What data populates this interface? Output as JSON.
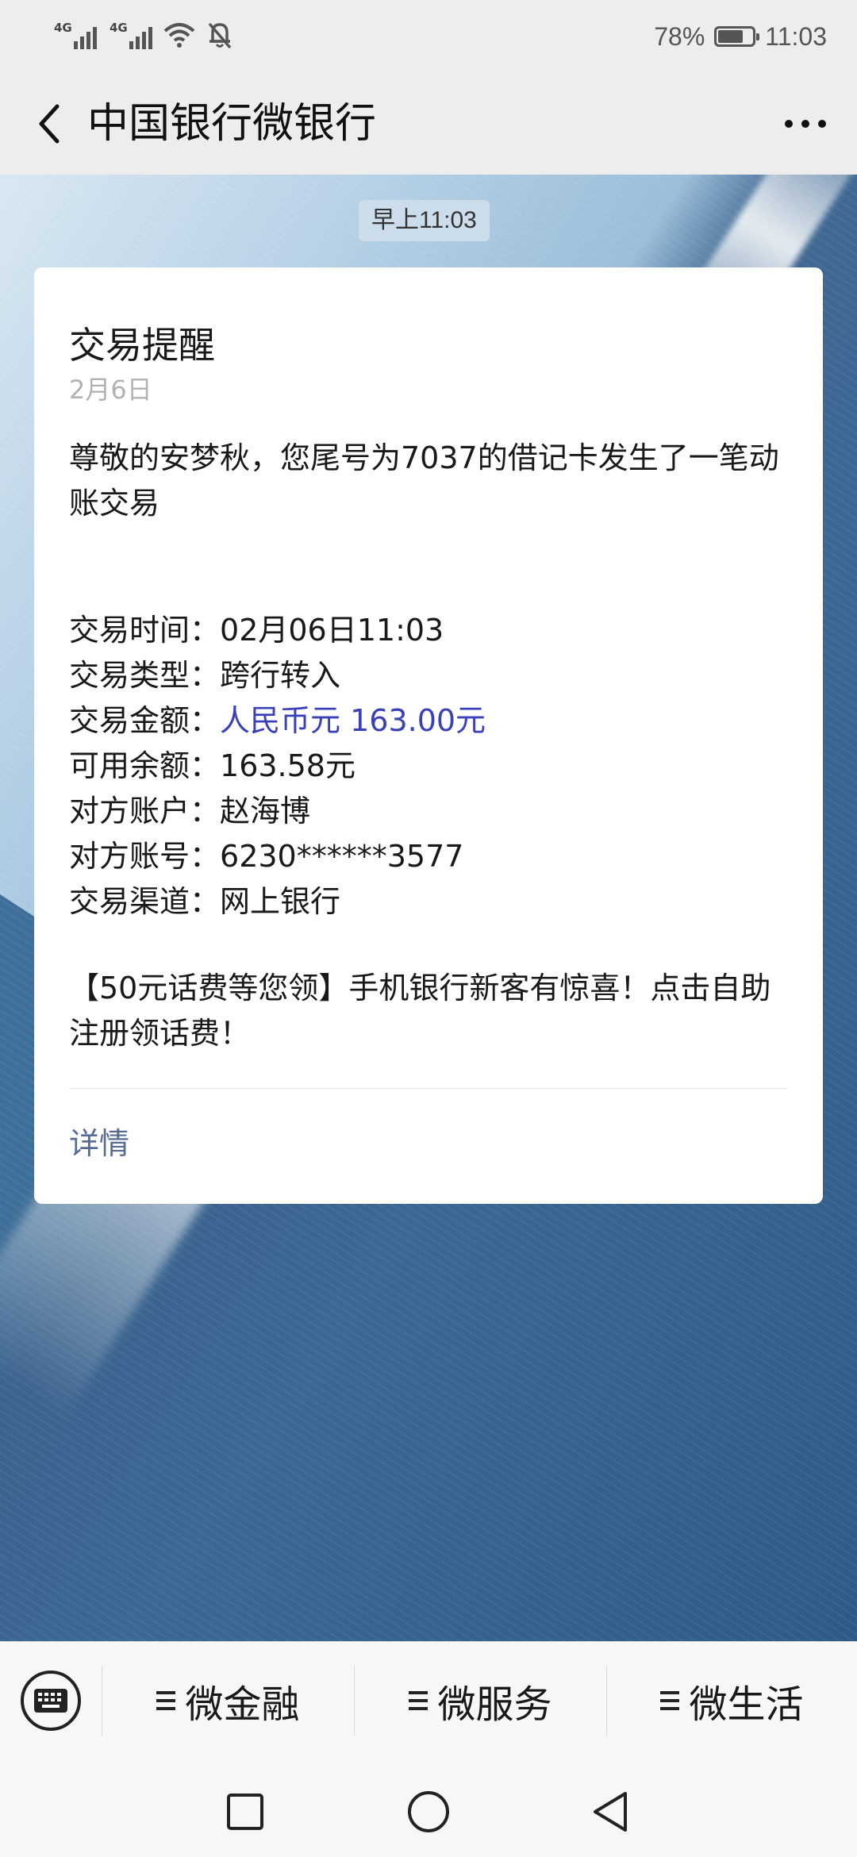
{
  "status_bar": {
    "network_1": "4G",
    "network_2": "4G",
    "battery_percent_text": "78%",
    "battery_level": 0.78,
    "time": "11:03",
    "icons": [
      "signal-icon",
      "signal-icon",
      "wifi-icon",
      "bell-off-icon",
      "battery-icon"
    ]
  },
  "header": {
    "title": "中国银行微银行",
    "back_icon": "chevron-left-icon",
    "more_icon": "more-dots-icon"
  },
  "chat": {
    "timestamp": "早上11:03"
  },
  "card": {
    "title": "交易提醒",
    "date": "2月6日",
    "intro": "尊敬的安梦秋，您尾号为7037的借记卡发生了一笔动账交易",
    "fields": [
      {
        "label": "交易时间：",
        "value": "02月06日11:03"
      },
      {
        "label": "交易类型：",
        "value": "跨行转入"
      },
      {
        "label": "交易金额：",
        "value": "人民币元 163.00元"
      },
      {
        "label": "可用余额：",
        "value": "163.58元"
      },
      {
        "label": "对方账户：",
        "value": "赵海博"
      },
      {
        "label": "对方账号：",
        "value": "6230******3577"
      },
      {
        "label": "交易渠道：",
        "value": "网上银行"
      }
    ],
    "promo": "【50元话费等您领】手机银行新客有惊喜！点击自助注册领话费！",
    "detail_link": "详情",
    "amount_color": "#3a40b8",
    "link_color": "#576b95"
  },
  "menu": {
    "keyboard_icon": "keyboard-icon",
    "items": [
      {
        "label": "微金融",
        "icon": "menu-lines-icon"
      },
      {
        "label": "微服务",
        "icon": "menu-lines-icon"
      },
      {
        "label": "微生活",
        "icon": "menu-lines-icon"
      }
    ]
  },
  "nav": {
    "icons": [
      "recent-apps-icon",
      "home-icon",
      "back-icon"
    ]
  }
}
